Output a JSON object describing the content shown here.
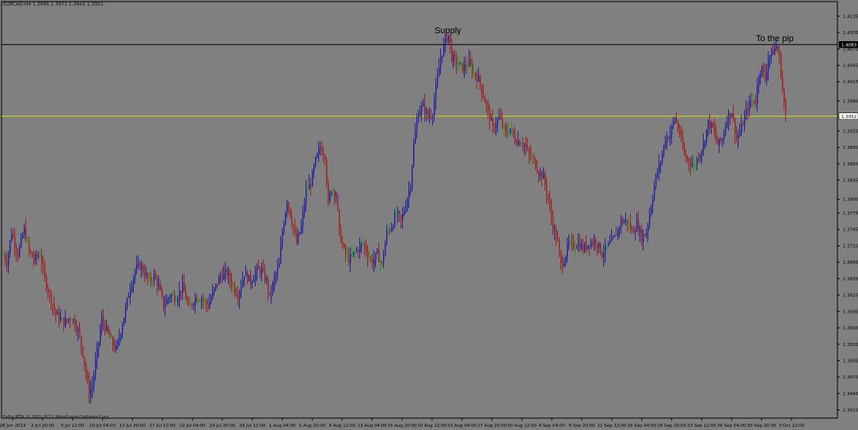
{
  "chart_info": "EURCAD,H4  1.3966 1.3971 1.3942 1.3952",
  "copyright": "FxPro MT4, © 2001-2013, MetaQuotes Software Corp.",
  "annotations": [
    {
      "text": "Supply"
    },
    {
      "text": "To the pip"
    }
  ],
  "colors": {
    "background": "#808080",
    "bull_candle": "#1e1ea0",
    "bear_candle": "#a01e1e",
    "doji_candle": "#1aa01a",
    "resistance_line": "#000000",
    "current_price_line": "#d8d800",
    "axis_text": "#000000"
  },
  "chart_data": {
    "type": "candlestick",
    "symbol": "EURCAD",
    "timeframe": "H4",
    "ylim": [
      1.34,
      1.415
    ],
    "y_ticks": [
      "1.4135",
      "1.4105",
      "1.4075",
      "1.4045",
      "1.4015",
      "1.3980",
      "1.3950",
      "1.3925",
      "1.3895",
      "1.3865",
      "1.3835",
      "1.3800",
      "1.3775",
      "1.3745",
      "1.3715",
      "1.3685",
      "1.3655",
      "1.3625",
      "1.3595",
      "1.3565",
      "1.3535",
      "1.3505",
      "1.3475",
      "1.3445",
      "1.3415"
    ],
    "x_ticks": [
      "28 Jun 2013",
      "2 Jul 20:00",
      "5 Jul 12:00",
      "10 Jul 04:00",
      "12 Jul 20:00",
      "17 Jul 12:00",
      "22 Jul 04:00",
      "24 Jul 20:00",
      "29 Jul 12:00",
      "1 Aug 04:00",
      "5 Aug 20:00",
      "8 Aug 12:00",
      "13 Aug 04:00",
      "15 Aug 20:00",
      "20 Aug 12:00",
      "23 Aug 04:00",
      "27 Aug 20:00",
      "30 Aug 12:00",
      "4 Sep 04:00",
      "6 Sep 20:00",
      "11 Sep 12:00",
      "16 Sep 04:00",
      "18 Sep 20:00",
      "23 Sep 12:00",
      "26 Sep 04:00",
      "30 Sep 20:00",
      "3 Oct 12:00"
    ],
    "horizontal_lines": [
      {
        "price": 1.4083,
        "label": "1.4083",
        "color": "#000000"
      },
      {
        "price": 1.3952,
        "label": "1.3952",
        "color": "#d8d800"
      }
    ],
    "price_path": [
      [
        0,
        1.371
      ],
      [
        8,
        1.3685
      ],
      [
        14,
        1.374
      ],
      [
        22,
        1.37
      ],
      [
        30,
        1.3745
      ],
      [
        36,
        1.3705
      ],
      [
        42,
        1.369
      ],
      [
        50,
        1.37
      ],
      [
        56,
        1.3655
      ],
      [
        62,
        1.3625
      ],
      [
        70,
        1.359
      ],
      [
        80,
        1.3575
      ],
      [
        90,
        1.3585
      ],
      [
        98,
        1.356
      ],
      [
        104,
        1.352
      ],
      [
        108,
        1.348
      ],
      [
        112,
        1.3445
      ],
      [
        116,
        1.346
      ],
      [
        122,
        1.352
      ],
      [
        128,
        1.358
      ],
      [
        134,
        1.356
      ],
      [
        140,
        1.354
      ],
      [
        146,
        1.3525
      ],
      [
        152,
        1.356
      ],
      [
        158,
        1.36
      ],
      [
        164,
        1.364
      ],
      [
        170,
        1.367
      ],
      [
        176,
        1.368
      ],
      [
        182,
        1.3665
      ],
      [
        188,
        1.365
      ],
      [
        194,
        1.366
      ],
      [
        200,
        1.364
      ],
      [
        206,
        1.3605
      ],
      [
        214,
        1.3625
      ],
      [
        222,
        1.362
      ],
      [
        230,
        1.364
      ],
      [
        238,
        1.36
      ],
      [
        246,
        1.362
      ],
      [
        254,
        1.362
      ],
      [
        262,
        1.3605
      ],
      [
        270,
        1.3635
      ],
      [
        278,
        1.366
      ],
      [
        286,
        1.3665
      ],
      [
        294,
        1.364
      ],
      [
        300,
        1.3625
      ],
      [
        308,
        1.3665
      ],
      [
        316,
        1.365
      ],
      [
        324,
        1.367
      ],
      [
        330,
        1.367
      ],
      [
        336,
        1.365
      ],
      [
        340,
        1.362
      ],
      [
        346,
        1.3655
      ],
      [
        352,
        1.368
      ],
      [
        356,
        1.374
      ],
      [
        362,
        1.38
      ],
      [
        368,
        1.376
      ],
      [
        374,
        1.372
      ],
      [
        380,
        1.375
      ],
      [
        386,
        1.3815
      ],
      [
        392,
        1.383
      ],
      [
        398,
        1.387
      ],
      [
        404,
        1.3895
      ],
      [
        410,
        1.388
      ],
      [
        414,
        1.379
      ],
      [
        418,
        1.382
      ],
      [
        424,
        1.381
      ],
      [
        428,
        1.374
      ],
      [
        434,
        1.3705
      ],
      [
        440,
        1.369
      ],
      [
        446,
        1.37
      ],
      [
        452,
        1.371
      ],
      [
        458,
        1.372
      ],
      [
        464,
        1.37
      ],
      [
        470,
        1.3685
      ],
      [
        476,
        1.37
      ],
      [
        482,
        1.368
      ],
      [
        488,
        1.374
      ],
      [
        494,
        1.375
      ],
      [
        500,
        1.3775
      ],
      [
        506,
        1.376
      ],
      [
        512,
        1.379
      ],
      [
        518,
        1.383
      ],
      [
        522,
        1.39
      ],
      [
        528,
        1.396
      ],
      [
        534,
        1.397
      ],
      [
        540,
        1.395
      ],
      [
        546,
        1.396
      ],
      [
        552,
        1.402
      ],
      [
        556,
        1.406
      ],
      [
        562,
        1.409
      ],
      [
        566,
        1.41
      ],
      [
        570,
        1.406
      ],
      [
        576,
        1.405
      ],
      [
        584,
        1.404
      ],
      [
        592,
        1.405
      ],
      [
        598,
        1.403
      ],
      [
        604,
        1.402
      ],
      [
        610,
        1.399
      ],
      [
        616,
        1.396
      ],
      [
        622,
        1.393
      ],
      [
        630,
        1.395
      ],
      [
        638,
        1.392
      ],
      [
        644,
        1.393
      ],
      [
        650,
        1.391
      ],
      [
        656,
        1.3905
      ],
      [
        662,
        1.39
      ],
      [
        668,
        1.388
      ],
      [
        674,
        1.387
      ],
      [
        680,
        1.385
      ],
      [
        686,
        1.384
      ],
      [
        692,
        1.38
      ],
      [
        698,
        1.375
      ],
      [
        704,
        1.372
      ],
      [
        708,
        1.368
      ],
      [
        712,
        1.369
      ],
      [
        718,
        1.372
      ],
      [
        724,
        1.3715
      ],
      [
        730,
        1.372
      ],
      [
        736,
        1.371
      ],
      [
        744,
        1.372
      ],
      [
        752,
        1.3725
      ],
      [
        760,
        1.37
      ],
      [
        768,
        1.3715
      ],
      [
        776,
        1.373
      ],
      [
        784,
        1.376
      ],
      [
        792,
        1.376
      ],
      [
        798,
        1.374
      ],
      [
        804,
        1.3755
      ],
      [
        810,
        1.373
      ],
      [
        816,
        1.374
      ],
      [
        822,
        1.379
      ],
      [
        828,
        1.384
      ],
      [
        834,
        1.387
      ],
      [
        840,
        1.391
      ],
      [
        846,
        1.392
      ],
      [
        852,
        1.395
      ],
      [
        858,
        1.392
      ],
      [
        864,
        1.388
      ],
      [
        870,
        1.387
      ],
      [
        876,
        1.386
      ],
      [
        882,
        1.388
      ],
      [
        888,
        1.39
      ],
      [
        894,
        1.394
      ],
      [
        900,
        1.393
      ],
      [
        906,
        1.39
      ],
      [
        912,
        1.391
      ],
      [
        918,
        1.395
      ],
      [
        924,
        1.396
      ],
      [
        930,
        1.391
      ],
      [
        936,
        1.393
      ],
      [
        942,
        1.396
      ],
      [
        948,
        1.398
      ],
      [
        954,
        1.398
      ],
      [
        958,
        1.403
      ],
      [
        962,
        1.404
      ],
      [
        966,
        1.402
      ],
      [
        970,
        1.406
      ],
      [
        976,
        1.407
      ],
      [
        980,
        1.408
      ],
      [
        984,
        1.406
      ],
      [
        988,
        1.4
      ],
      [
        992,
        1.3952
      ]
    ]
  }
}
